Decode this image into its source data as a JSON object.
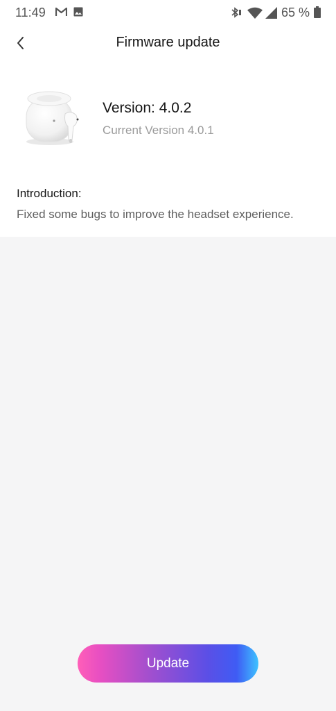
{
  "status_bar": {
    "time": "11:49",
    "battery_percent": "65 %",
    "icons": [
      "gmail-icon",
      "gallery-icon",
      "bluetooth-icon",
      "wifi-icon",
      "signal-icon",
      "battery-icon"
    ]
  },
  "header": {
    "title": "Firmware update",
    "back_icon": "back-chevron-icon"
  },
  "device": {
    "image": "earbuds-case-image",
    "version": "Version: 4.0.2",
    "current_version": "Current Version 4.0.1"
  },
  "introduction": {
    "heading": "Introduction:",
    "text": "Fixed some bugs to improve the headset experience."
  },
  "actions": {
    "update_label": "Update"
  },
  "colors": {
    "page_background": "#f5f5f6",
    "card_background": "#ffffff",
    "gradient_start": "#ff5fb8",
    "gradient_mid": "#5b4fe6",
    "gradient_end": "#3dc2ff"
  }
}
